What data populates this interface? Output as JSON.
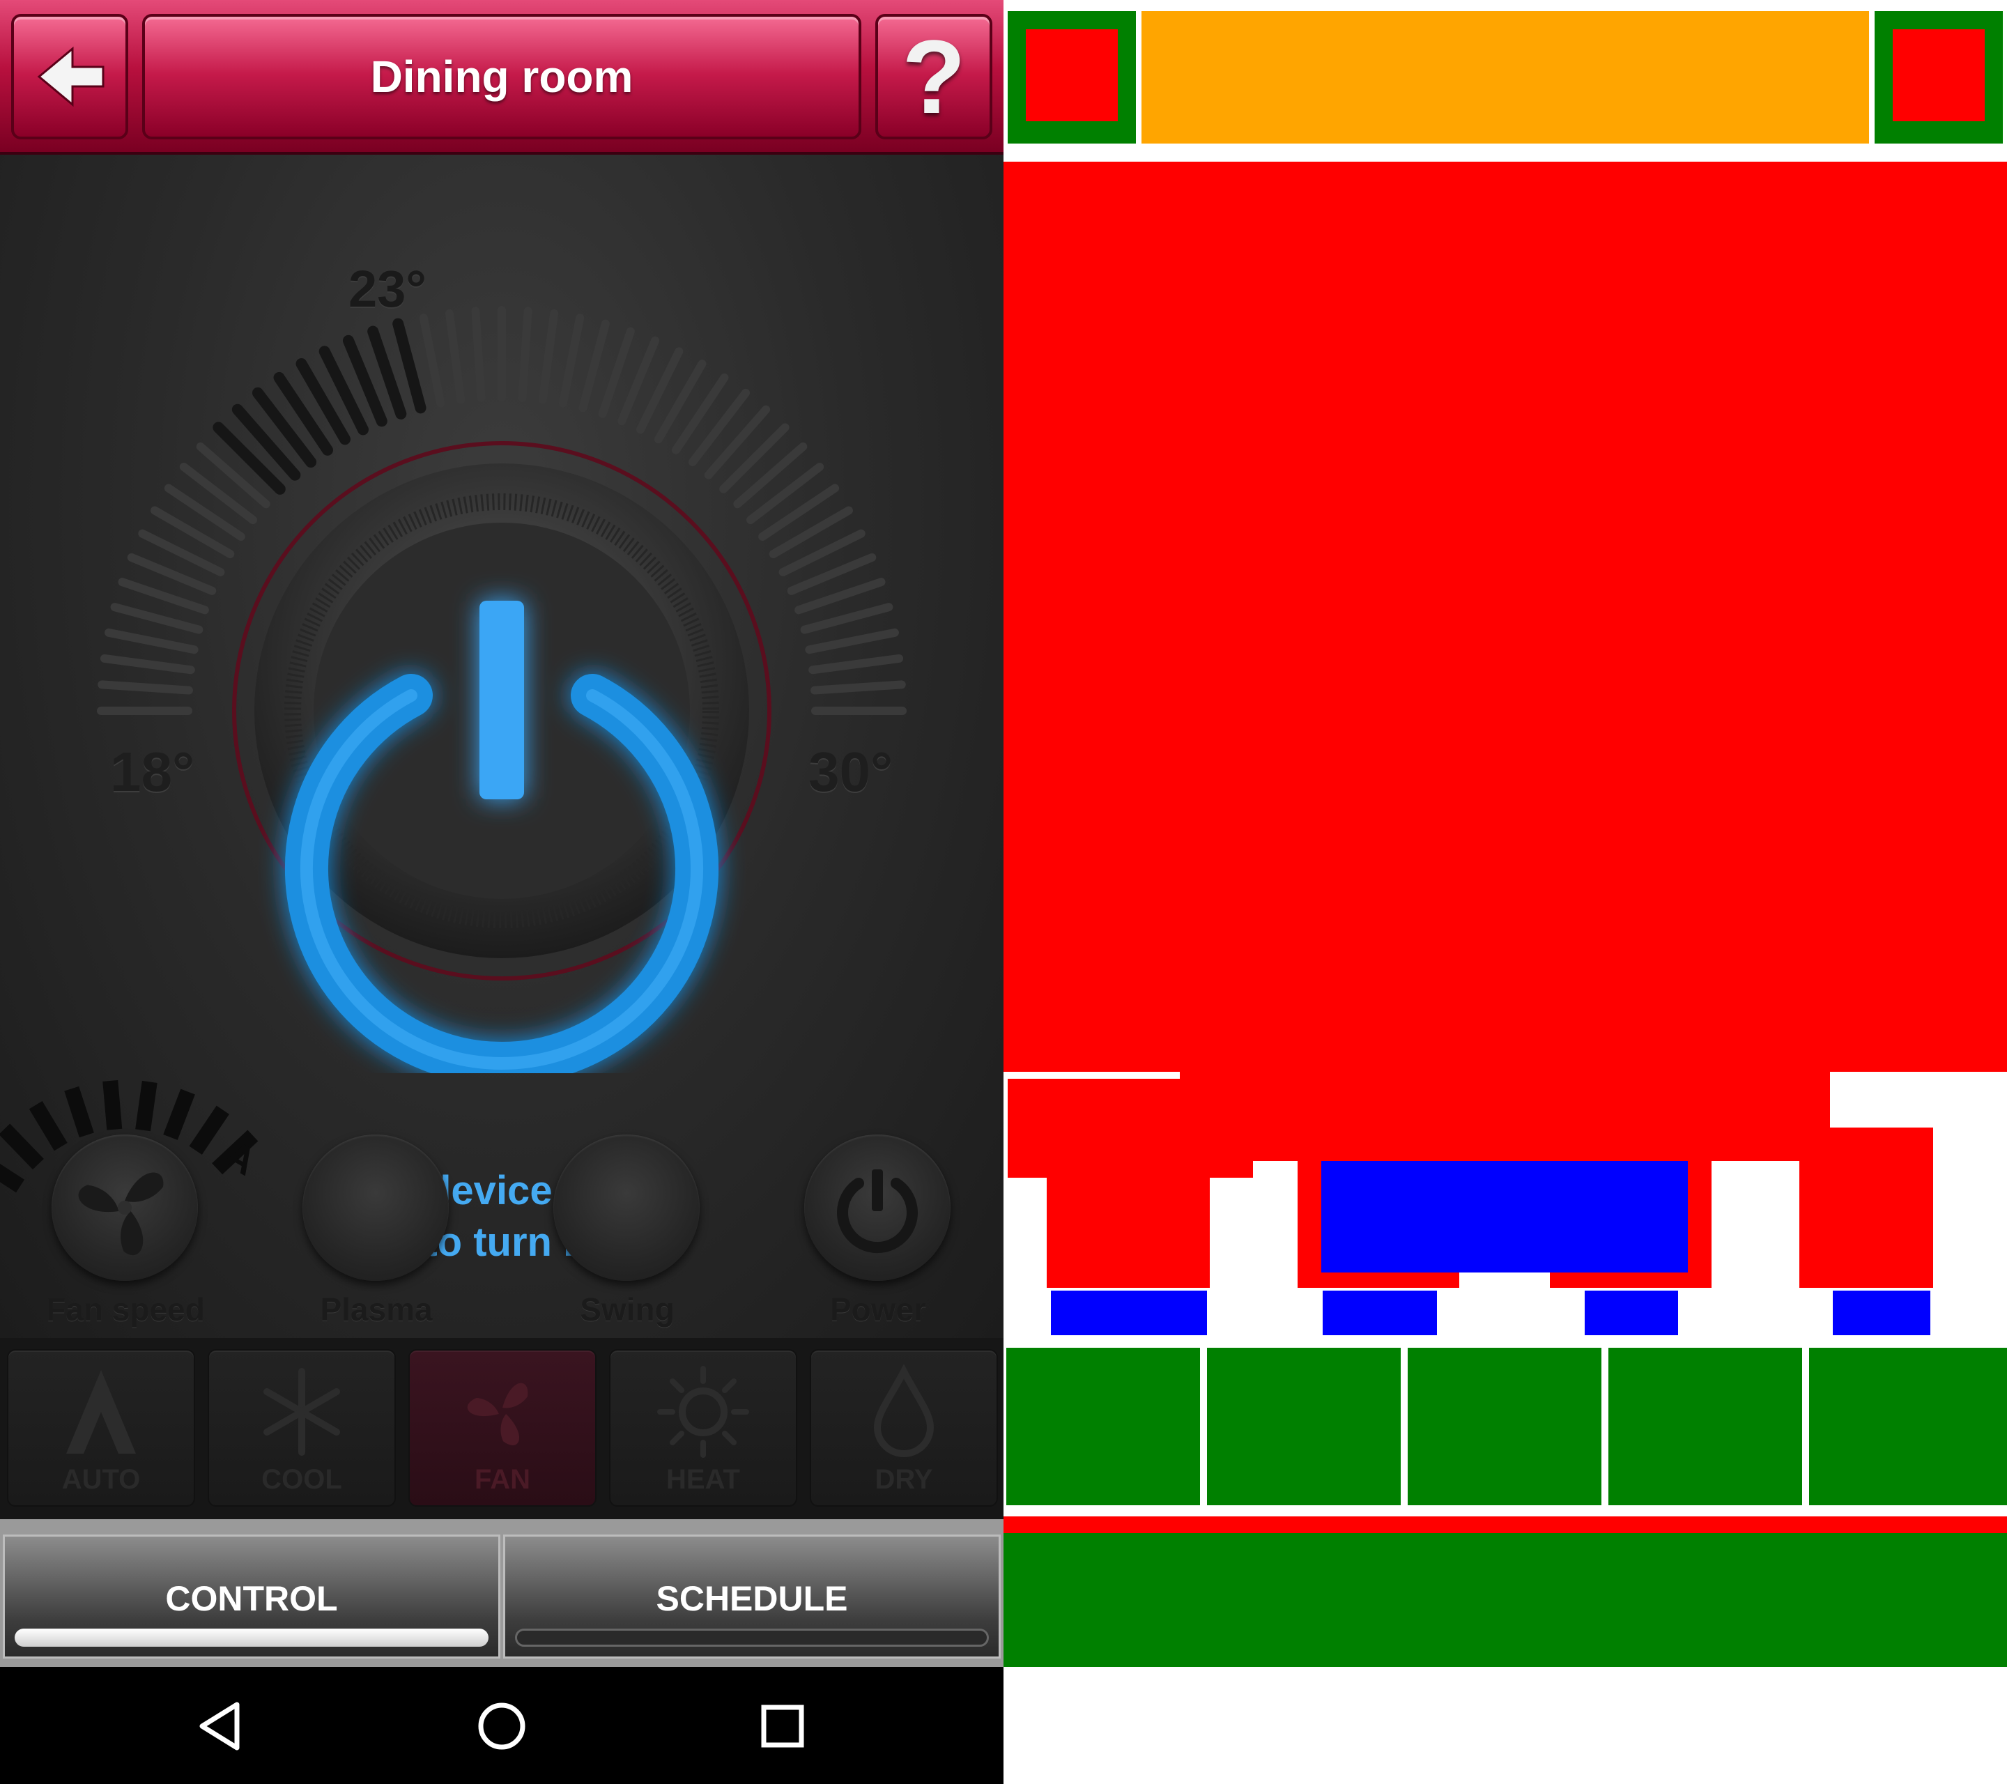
{
  "app": {
    "header": {
      "title": "Dining room",
      "back_icon": "arrow-left-icon",
      "help_label": "?"
    },
    "thermostat": {
      "setpoint_label": "23°",
      "min_label": "18°",
      "max_label": "30°",
      "setpoint": 23,
      "min": 18,
      "max": 30
    },
    "status": {
      "line1": "This device is off.",
      "line2": "Tap to turn it on."
    },
    "controls": [
      {
        "label": "Fan speed",
        "icon": "fan-icon"
      },
      {
        "label": "Plasma",
        "icon": "plasma-icon"
      },
      {
        "label": "Swing",
        "icon": "swing-icon"
      },
      {
        "label": "Power",
        "icon": "power-icon"
      }
    ],
    "modes": [
      {
        "label": "AUTO",
        "icon": "auto-icon",
        "active": false
      },
      {
        "label": "COOL",
        "icon": "snowflake-icon",
        "active": false
      },
      {
        "label": "FAN",
        "icon": "fan-icon",
        "active": true
      },
      {
        "label": "HEAT",
        "icon": "sun-icon",
        "active": false
      },
      {
        "label": "DRY",
        "icon": "droplet-icon",
        "active": false
      }
    ],
    "tabs": [
      {
        "label": "CONTROL",
        "selected": true
      },
      {
        "label": "SCHEDULE",
        "selected": false
      }
    ],
    "system_nav": [
      "back-icon",
      "home-icon",
      "recents-icon"
    ]
  },
  "colors": {
    "accent_blue": "#45aaf2",
    "header_pink": "#c51a4a",
    "mask_green": "#008000",
    "mask_red": "#ff0000",
    "mask_blue": "#0000ff",
    "mask_orange": "#ffa500"
  }
}
